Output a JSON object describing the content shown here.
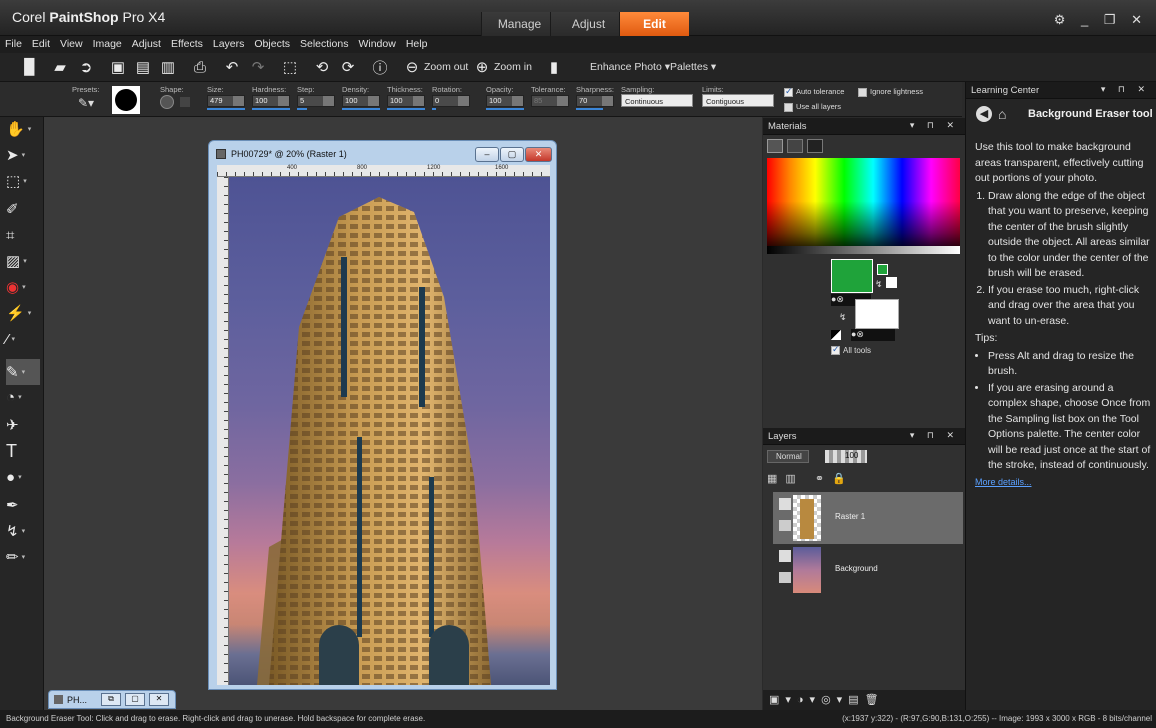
{
  "app": {
    "title_brand": "Corel",
    "title_name": "PaintShop",
    "title_suffix": "Pro X4",
    "workspace_tabs": [
      {
        "label": "Manage",
        "active": false
      },
      {
        "label": "Adjust",
        "active": false
      },
      {
        "label": "Edit",
        "active": true
      }
    ],
    "window_controls": "⚙ _ ❐ ✕",
    "accent_color": "#f2661e"
  },
  "menu": [
    "File",
    "Edit",
    "View",
    "Image",
    "Adjust",
    "Effects",
    "Layers",
    "Objects",
    "Selections",
    "Window",
    "Help"
  ],
  "toolbar": {
    "zoom_out_label": "Zoom out",
    "zoom_in_label": "Zoom in",
    "enhance_photo_label": "Enhance Photo ▾",
    "palettes_label": "Palettes ▾",
    "icons": [
      "new-file-icon",
      "open-icon",
      "browse-icon",
      "save-icon",
      "save-as-icon",
      "save-copy-icon",
      "print-icon",
      "undo-icon",
      "redo-icon",
      "resize-icon",
      "rotate-left-icon",
      "rotate-right-icon",
      "info-icon",
      "zoom-out-icon",
      "zoom-in-icon",
      "paste-icon"
    ]
  },
  "tool_options": {
    "presets_label": "Presets:",
    "shape_label": "Shape:",
    "size_label": "Size:",
    "size_value": "479",
    "hardness_label": "Hardness:",
    "hardness_value": "100",
    "step_label": "Step:",
    "step_value": "5",
    "density_label": "Density:",
    "density_value": "100",
    "thickness_label": "Thickness:",
    "thickness_value": "100",
    "rotation_label": "Rotation:",
    "rotation_value": "0",
    "opacity_label": "Opacity:",
    "opacity_value": "100",
    "tolerance_label": "Tolerance:",
    "tolerance_value": "85",
    "sharpness_label": "Sharpness:",
    "sharpness_value": "70",
    "sampling_label": "Sampling:",
    "sampling_value": "Continuous",
    "limits_label": "Limits:",
    "limits_value": "Contiguous",
    "auto_tolerance_label": "Auto tolerance",
    "use_all_layers_label": "Use all layers",
    "ignore_lightness_label": "Ignore lightness"
  },
  "document": {
    "title": "PH00729* @  20% (Raster 1)",
    "ruler_marks": [
      "400",
      "800",
      "1200",
      "1600"
    ],
    "minimized_title": "PH..."
  },
  "materials": {
    "title": "Materials",
    "foreground_color": "#1fa33a",
    "background_color": "#ffffff",
    "all_tools_label": "All tools"
  },
  "layers": {
    "title": "Layers",
    "blend_mode": "Normal",
    "opacity": "100",
    "items": [
      {
        "name": "Raster 1",
        "selected": true
      },
      {
        "name": "Background",
        "selected": false
      }
    ]
  },
  "learning_center": {
    "title": "Learning Center",
    "tool_name": "Background Eraser tool",
    "intro": "Use this tool to make background areas transparent, effectively cutting out portions of your photo.",
    "steps": [
      "Draw along the edge of the object that you want to preserve, keeping the center of the brush slightly outside the object. All areas similar to the color under the center of the brush will be erased.",
      "If you erase too much, right-click and drag over the area that you want to un-erase."
    ],
    "tips_label": "Tips:",
    "tips": [
      "Press Alt and drag to resize the brush.",
      "If you are erasing around a complex shape, choose Once from the Sampling list box on the Tool Options palette. The center color will be read just once at the start of the stroke, instead of continuously."
    ],
    "more_details": "More details..."
  },
  "status": {
    "left": "Background Eraser Tool: Click and drag to erase. Right-click and drag to unerase. Hold backspace for complete erase.",
    "right": "(x:1937 y:322) - (R:97,G:90,B:131,O:255) -- Image:  1993 x 3000 x RGB - 8 bits/channel"
  }
}
